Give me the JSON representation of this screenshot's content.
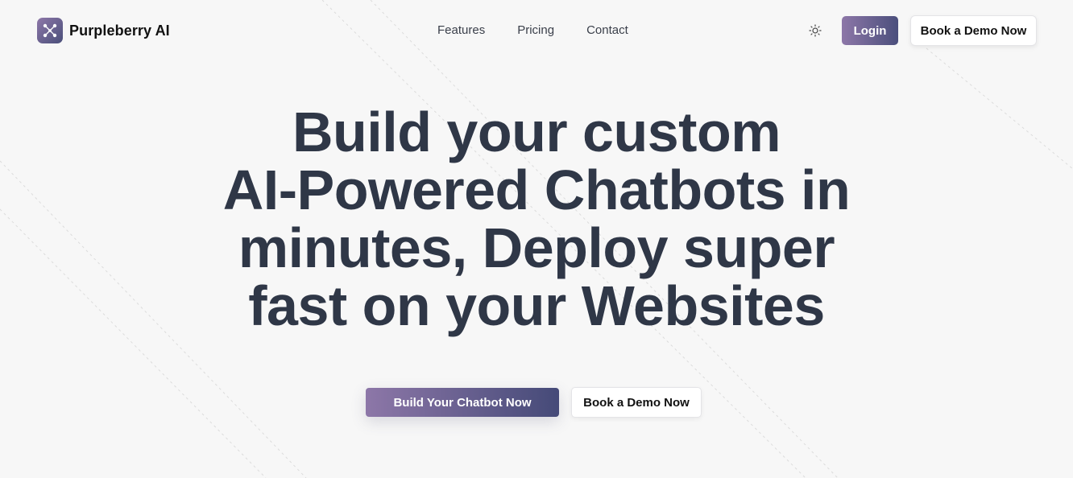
{
  "header": {
    "brand_name": "Purpleberry AI",
    "nav": [
      {
        "label": "Features"
      },
      {
        "label": "Pricing"
      },
      {
        "label": "Contact"
      }
    ],
    "theme_icon": "sun-icon",
    "login_label": "Login",
    "demo_label": "Book a Demo Now"
  },
  "hero": {
    "title_lines": [
      "Build your custom",
      "AI-Powered Chatbots in",
      "minutes, Deploy super",
      "fast on your Websites"
    ],
    "primary_cta": "Build Your Chatbot Now",
    "secondary_cta": "Book a Demo Now"
  },
  "theme": {
    "accent_start": "#8d77a8",
    "accent_end": "#454a78",
    "heading_color": "#2f3747",
    "background": "#f7f7f7"
  }
}
